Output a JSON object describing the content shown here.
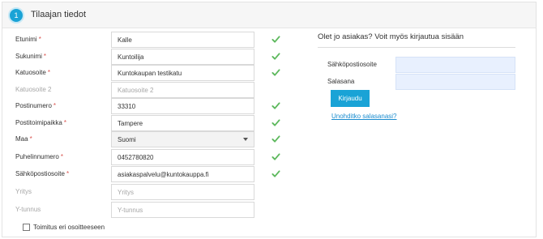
{
  "header": {
    "step": "1",
    "title": "Tilaajan tiedot"
  },
  "form": {
    "fields": [
      {
        "label": "Etunimi",
        "required": true,
        "value": "Kalle",
        "placeholder": "",
        "valid": true,
        "muted": false
      },
      {
        "label": "Sukunimi",
        "required": true,
        "value": "Kuntoilija",
        "placeholder": "",
        "valid": true,
        "muted": false
      },
      {
        "label": "Katuosoite",
        "required": true,
        "value": "Kuntokaupan testikatu",
        "placeholder": "",
        "valid": true,
        "muted": false
      },
      {
        "label": "Katuosoite 2",
        "required": false,
        "value": "",
        "placeholder": "Katuosoite 2",
        "valid": false,
        "muted": true
      },
      {
        "label": "Postinumero",
        "required": true,
        "value": "33310",
        "placeholder": "",
        "valid": true,
        "muted": false
      },
      {
        "label": "Postitoimipaikka",
        "required": true,
        "value": "Tampere",
        "placeholder": "",
        "valid": true,
        "muted": false
      },
      {
        "label": "Maa",
        "required": true,
        "value": "Suomi",
        "placeholder": "",
        "valid": true,
        "muted": false,
        "type": "select"
      },
      {
        "label": "Puhelinnumero",
        "required": true,
        "value": "0452780820",
        "placeholder": "",
        "valid": true,
        "muted": false
      },
      {
        "label": "Sähköpostiosoite",
        "required": true,
        "value": "asiakaspalvelu@kuntokauppa.fi",
        "placeholder": "",
        "valid": true,
        "muted": false
      },
      {
        "label": "Yritys",
        "required": false,
        "value": "",
        "placeholder": "Yritys",
        "valid": false,
        "muted": true
      },
      {
        "label": "Y-tunnus",
        "required": false,
        "value": "",
        "placeholder": "Y-tunnus",
        "valid": false,
        "muted": true
      }
    ],
    "required_mark": "*",
    "separate_address_label": "Toimitus eri osoitteeseen",
    "separate_address_checked": false
  },
  "login": {
    "title": "Olet jo asiakas? Voit myös kirjautua sisään",
    "email_label": "Sähköpostiosoite",
    "password_label": "Salasana",
    "submit_label": "Kirjaudu",
    "forgot_link": "Unohditko salasanasi?"
  },
  "colors": {
    "accent": "#1aa3d6",
    "valid": "#5cb85c",
    "required": "#d9534f"
  }
}
